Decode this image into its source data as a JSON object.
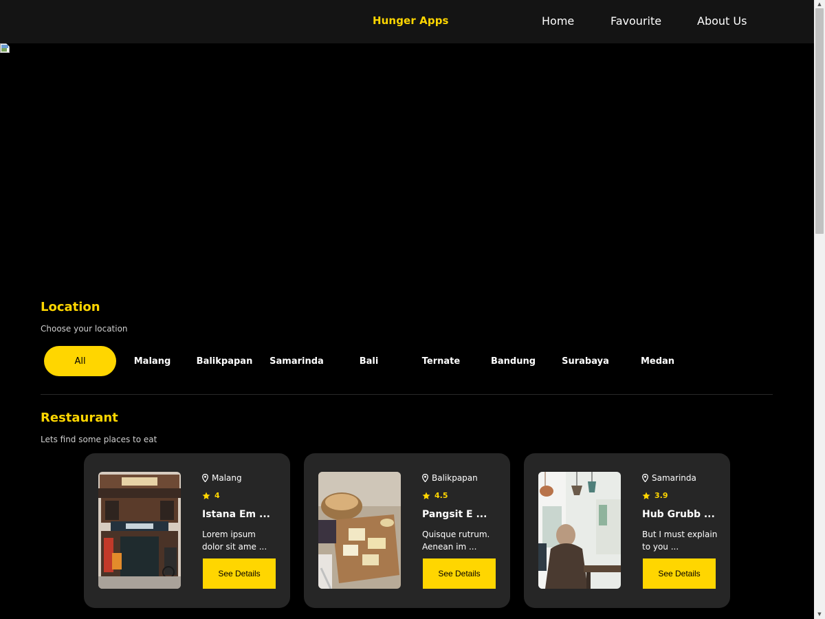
{
  "header": {
    "brand": "Hunger Apps",
    "nav": [
      {
        "label": "Home"
      },
      {
        "label": "Favourite"
      },
      {
        "label": "About Us"
      }
    ]
  },
  "location": {
    "title": "Location",
    "subtitle": "Choose your location",
    "options": [
      "All",
      "Malang",
      "Balikpapan",
      "Samarinda",
      "Bali",
      "Ternate",
      "Bandung",
      "Surabaya",
      "Medan"
    ],
    "selected": "All"
  },
  "restaurant": {
    "title": "Restaurant",
    "subtitle": "Lets find some places to eat",
    "cards": [
      {
        "city": "Malang",
        "rating": "4",
        "name": "Istana Em ...",
        "desc_line1": "Lorem ipsum",
        "desc_line2": "dolor sit ame ...",
        "button": "See Details"
      },
      {
        "city": "Balikpapan",
        "rating": "4.5",
        "name": "Pangsit E ...",
        "desc_line1": "Quisque rutrum.",
        "desc_line2": "Aenean im ...",
        "button": "See Details"
      },
      {
        "city": "Samarinda",
        "rating": "3.9",
        "name": "Hub Grubb ...",
        "desc_line1": "But I must explain",
        "desc_line2": "to you ...",
        "button": "See Details"
      }
    ]
  },
  "colors": {
    "accent": "#ffd600",
    "card_bg": "#262626",
    "navbar_bg": "#141414",
    "page_bg": "#000000"
  },
  "icons": {
    "location": "map-pin-icon",
    "rating": "star-icon"
  }
}
